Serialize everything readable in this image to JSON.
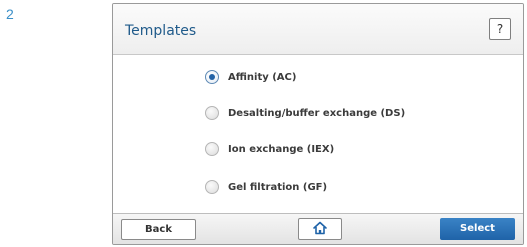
{
  "step_number": "2",
  "header": {
    "title": "Templates",
    "help_label": "?"
  },
  "templates": {
    "selected_index": 0,
    "options": [
      {
        "label": "Affinity (AC)",
        "selected": true
      },
      {
        "label": "Desalting/buffer exchange (DS)",
        "selected": false
      },
      {
        "label": "Ion exchange (IEX)",
        "selected": false
      },
      {
        "label": "Gel filtration (GF)",
        "selected": false
      }
    ]
  },
  "footer": {
    "back_label": "Back",
    "home_icon": "home-icon",
    "select_label": "Select"
  },
  "colors": {
    "accent": "#1f63a8",
    "title": "#1f5a8a",
    "step_number": "#3a8fc8"
  }
}
